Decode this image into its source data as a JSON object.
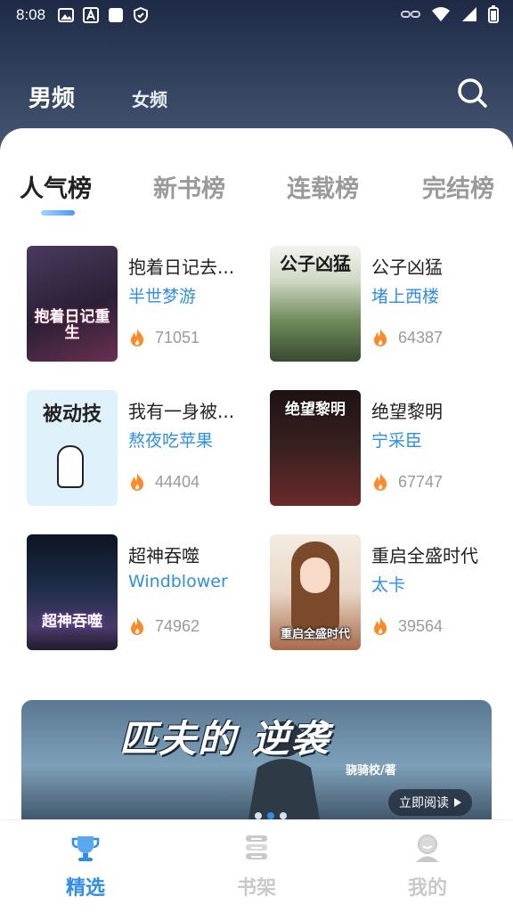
{
  "status_bar": {
    "time": "8:08"
  },
  "top_nav": {
    "tabs": [
      "男频",
      "女频"
    ],
    "active": 0
  },
  "rank_tabs": [
    "人气榜",
    "新书榜",
    "连载榜",
    "完结榜"
  ],
  "books": [
    {
      "title": "抱着日记去...",
      "author": "半世梦游",
      "heat": "71051",
      "cover_text": "抱着日记重生",
      "cover_color": "#3a2d4a"
    },
    {
      "title": "公子凶猛",
      "author": "堵上西楼",
      "heat": "64387",
      "cover_text": "公子凶猛",
      "cover_color": "#6f8a5a"
    },
    {
      "title": "我有一身被...",
      "author": "熬夜吃苹果",
      "heat": "44404",
      "cover_text": "被动技",
      "cover_color": "#dff1fa"
    },
    {
      "title": "绝望黎明",
      "author": "宁采臣",
      "heat": "67747",
      "cover_text": "绝望黎明",
      "cover_color": "#3a2020"
    },
    {
      "title": "超神吞噬",
      "author": "Windblower",
      "heat": "74962",
      "cover_text": "超神吞噬",
      "cover_color": "#1e2c48"
    },
    {
      "title": "重启全盛时代",
      "author": "太卡",
      "heat": "39564",
      "cover_text": "重启全盛时代",
      "cover_color": "#e9d6c6"
    }
  ],
  "banner": {
    "title": "匹夫的 逆袭",
    "author": "骁骑校/著",
    "button": "立即阅读"
  },
  "bottom_nav": [
    {
      "label": "精选",
      "icon": "trophy-icon"
    },
    {
      "label": "书架",
      "icon": "bookshelf-icon"
    },
    {
      "label": "我的",
      "icon": "profile-icon"
    }
  ],
  "colors": {
    "accent": "#2f8ee8",
    "header": "#2c3a55"
  }
}
